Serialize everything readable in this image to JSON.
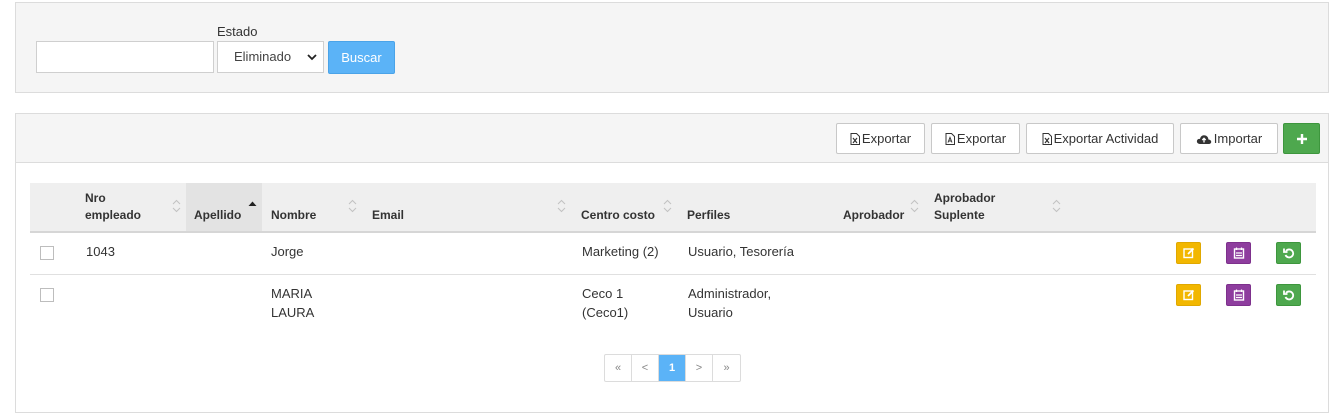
{
  "filters": {
    "search_value": "",
    "estado_label": "Estado",
    "estado_selected": "Eliminado",
    "buscar_label": "Buscar"
  },
  "toolbar": {
    "export_excel_label": "Exportar",
    "export_pdf_label": "Exportar",
    "export_activity_label": "Exportar Actividad",
    "import_label": "Importar"
  },
  "table": {
    "columns": {
      "nro_empleado_1": "Nro",
      "nro_empleado_2": "empleado",
      "apellido": "Apellido",
      "nombre": "Nombre",
      "email": "Email",
      "centro_costo": "Centro costo",
      "perfiles": "Perfiles",
      "aprobador": "Aprobador",
      "aprobador_suplente_1": "Aprobador",
      "aprobador_suplente_2": "Suplente"
    },
    "rows": [
      {
        "nro_empleado": "1043",
        "apellido": "",
        "nombre_1": "Jorge",
        "nombre_2": "",
        "email": "",
        "centro_costo_1": "Marketing (2)",
        "centro_costo_2": "",
        "perfiles_1": "Usuario, Tesorería",
        "perfiles_2": "",
        "aprobador": "",
        "aprobador_suplente": ""
      },
      {
        "nro_empleado": "",
        "apellido": "",
        "nombre_1": "MARIA",
        "nombre_2": "LAURA",
        "email": "",
        "centro_costo_1": "Ceco 1",
        "centro_costo_2": "(Ceco1)",
        "perfiles_1": "Administrador,",
        "perfiles_2": "Usuario",
        "aprobador": "",
        "aprobador_suplente": ""
      }
    ]
  },
  "pagination": {
    "first": "«",
    "prev": "<",
    "current": "1",
    "next": ">",
    "last": "»"
  },
  "colors": {
    "primary": "#5bb3f7",
    "success": "#4ea84e",
    "warning": "#f2b700",
    "purple": "#8e3d9e"
  },
  "icons": {
    "export_excel": "file-excel-icon",
    "export_pdf": "file-pdf-icon",
    "import": "cloud-upload-icon",
    "add": "plus-icon",
    "edit": "edit-icon",
    "calendar": "calendar-icon",
    "restore": "restore-icon"
  }
}
